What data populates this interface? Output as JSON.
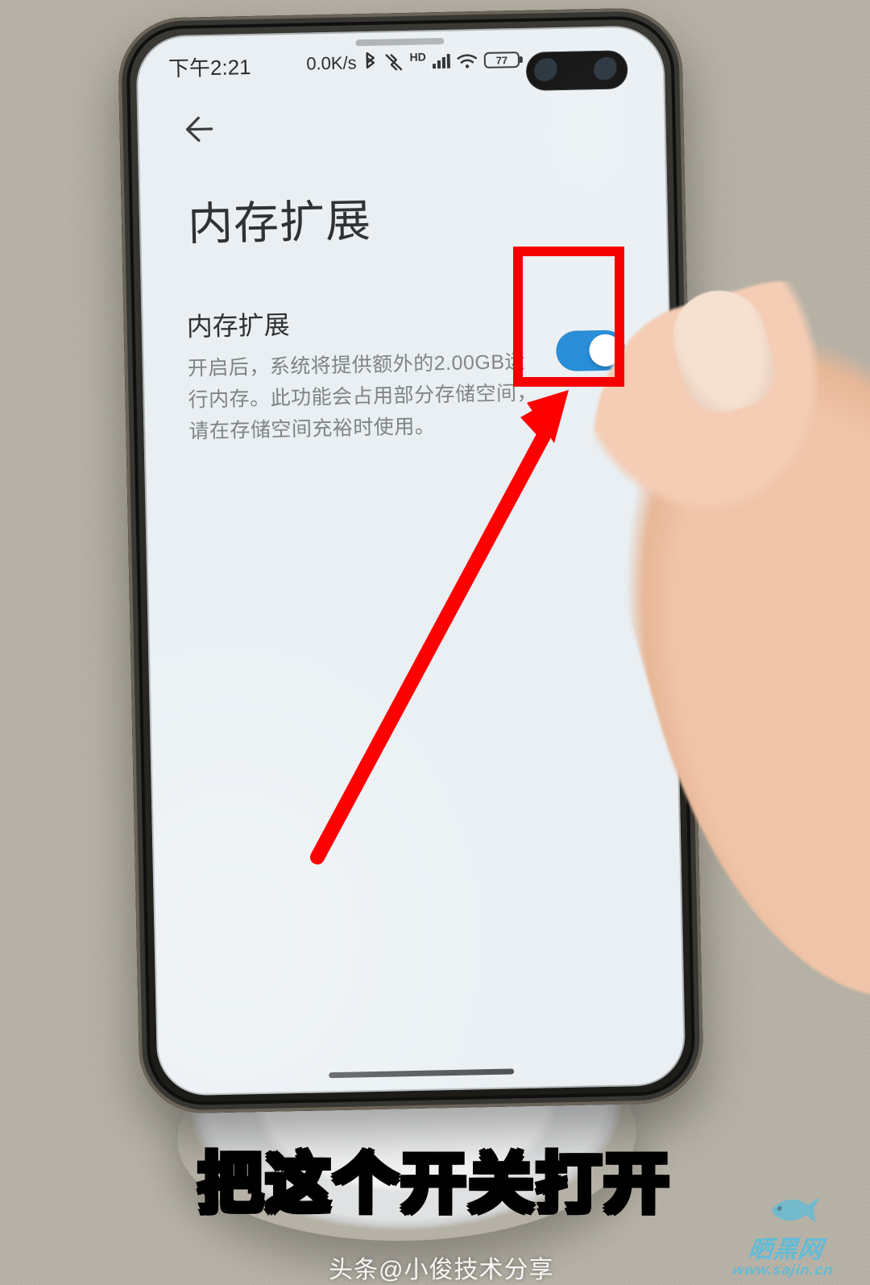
{
  "status_bar": {
    "time": "下午2:21",
    "net_speed": "0.0K/s",
    "bluetooth_icon": "bluetooth-icon",
    "vibrate_icon": "vibrate-icon",
    "hd_label": "HD",
    "signal_icon": "cell-signal-icon",
    "wifi_icon": "wifi-icon",
    "battery_percent": "77"
  },
  "page_title": "内存扩展",
  "setting": {
    "title": "内存扩展",
    "desc": "开启后，系统将提供额外的2.00GB运行内存。此功能会占用部分存储空间，请在存储空间充裕时使用。",
    "toggle_on": true
  },
  "annotations": {
    "highlight_color": "#f40000",
    "caption": "把这个开关打开",
    "arrow_color": "#ff0000"
  },
  "footer": {
    "source_tag": "头条@小俊技术分享"
  },
  "watermark": {
    "line1": "晒黑网",
    "line2": "www.sajin.cn"
  }
}
